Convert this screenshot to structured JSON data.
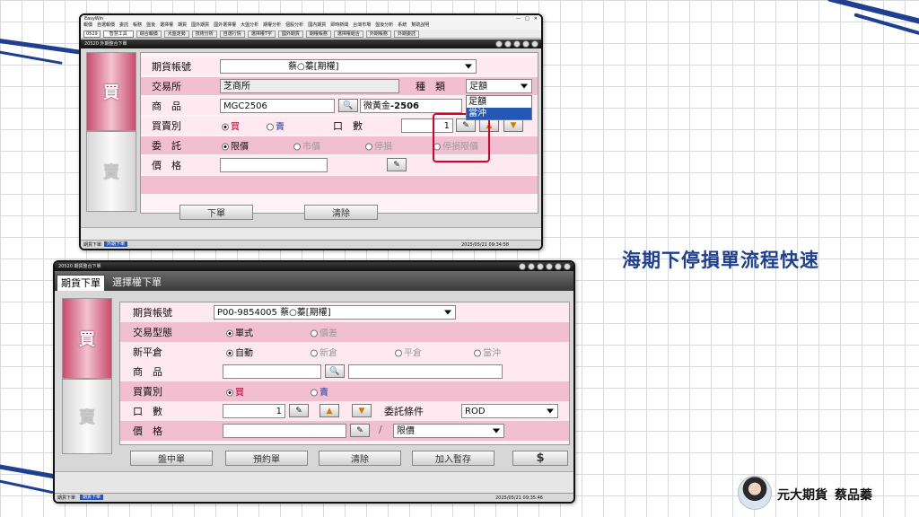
{
  "top_window": {
    "app_title": "EasyWin",
    "menu": [
      "報價",
      "自選報價",
      "委託",
      "帳務",
      "盤後",
      "選擇權",
      "期貨",
      "國外期貨",
      "國外選擇權",
      "大盤分析",
      "期權分析",
      "個股分析",
      "國內期貨",
      "即時新聞",
      "台灣市場",
      "盤後分析",
      "系統",
      "幫助說明"
    ],
    "toolbar_field": "0529",
    "toolbar_combo": "智慧工具",
    "toolbar_buttons": [
      "綜合報價",
      "大盤走勢",
      "技術分析",
      "自選行情",
      "選擇權T字",
      "國外期貨",
      "期權帳務",
      "選擇權組合",
      "外期帳務",
      "外期委託"
    ],
    "window_caption": "20520 外期整合下單",
    "buy_label": "買",
    "sell_label": "賣",
    "account_label": "期貨帳號",
    "account_value": "蔡○蓁[期權]",
    "exchange_label": "交易所",
    "exchange_value": "芝商所",
    "type_label": "種　類",
    "type_value": "足額",
    "type_options": [
      "足額",
      "當沖"
    ],
    "product_label": "商　品",
    "product_code": "MGC2506",
    "product_name_prefix": "微黃金",
    "product_name_suffix": "-2506",
    "side_label": "買賣別",
    "side_buy": "買",
    "side_sell": "賣",
    "qty_label": "口　數",
    "qty_value": "1",
    "order_label": "委　託",
    "order_types": [
      "限價",
      "市價",
      "停損",
      "停損限價"
    ],
    "price_label": "價　格",
    "submit_label": "下單",
    "clear_label": "清除",
    "status_time": "2025/05/21 09:34:58",
    "taskbar_items": [
      "期貨下單",
      "外期下單"
    ]
  },
  "bottom_window": {
    "window_caption": "20520 期貨整合下單",
    "tabs": [
      "期貨下單",
      "選擇權下單"
    ],
    "buy_label": "買",
    "sell_label": "賣",
    "account_label": "期貨帳號",
    "account_value": "P00-9854005  蔡○蓁[期權]",
    "trade_type_label": "交易型態",
    "trade_types": [
      "單式",
      "價差"
    ],
    "position_label": "新平倉",
    "position_types": [
      "自動",
      "新倉",
      "平倉",
      "當沖"
    ],
    "product_label": "商　品",
    "side_label": "買賣別",
    "side_buy": "買",
    "side_sell": "賣",
    "qty_label": "口　數",
    "qty_value": "1",
    "condition_label": "委託條件",
    "condition_value": "ROD",
    "price_label": "價　格",
    "price_type_value": "限價",
    "price_divider": "/",
    "actions": [
      "盤中單",
      "預約單",
      "清除",
      "加入暫存",
      "$"
    ],
    "status_time": "2025/05/21 09:35:46",
    "taskbar_items": [
      "期貨下單",
      "期貨下單"
    ]
  },
  "headline": "海期下停損單流程快速",
  "presenter": {
    "company": "元大期貨",
    "name": "蔡品蓁"
  },
  "colors": {
    "accent": "#1f3f8f",
    "pink_row": "#f1bfcf",
    "highlight_box": "#d8002a"
  }
}
